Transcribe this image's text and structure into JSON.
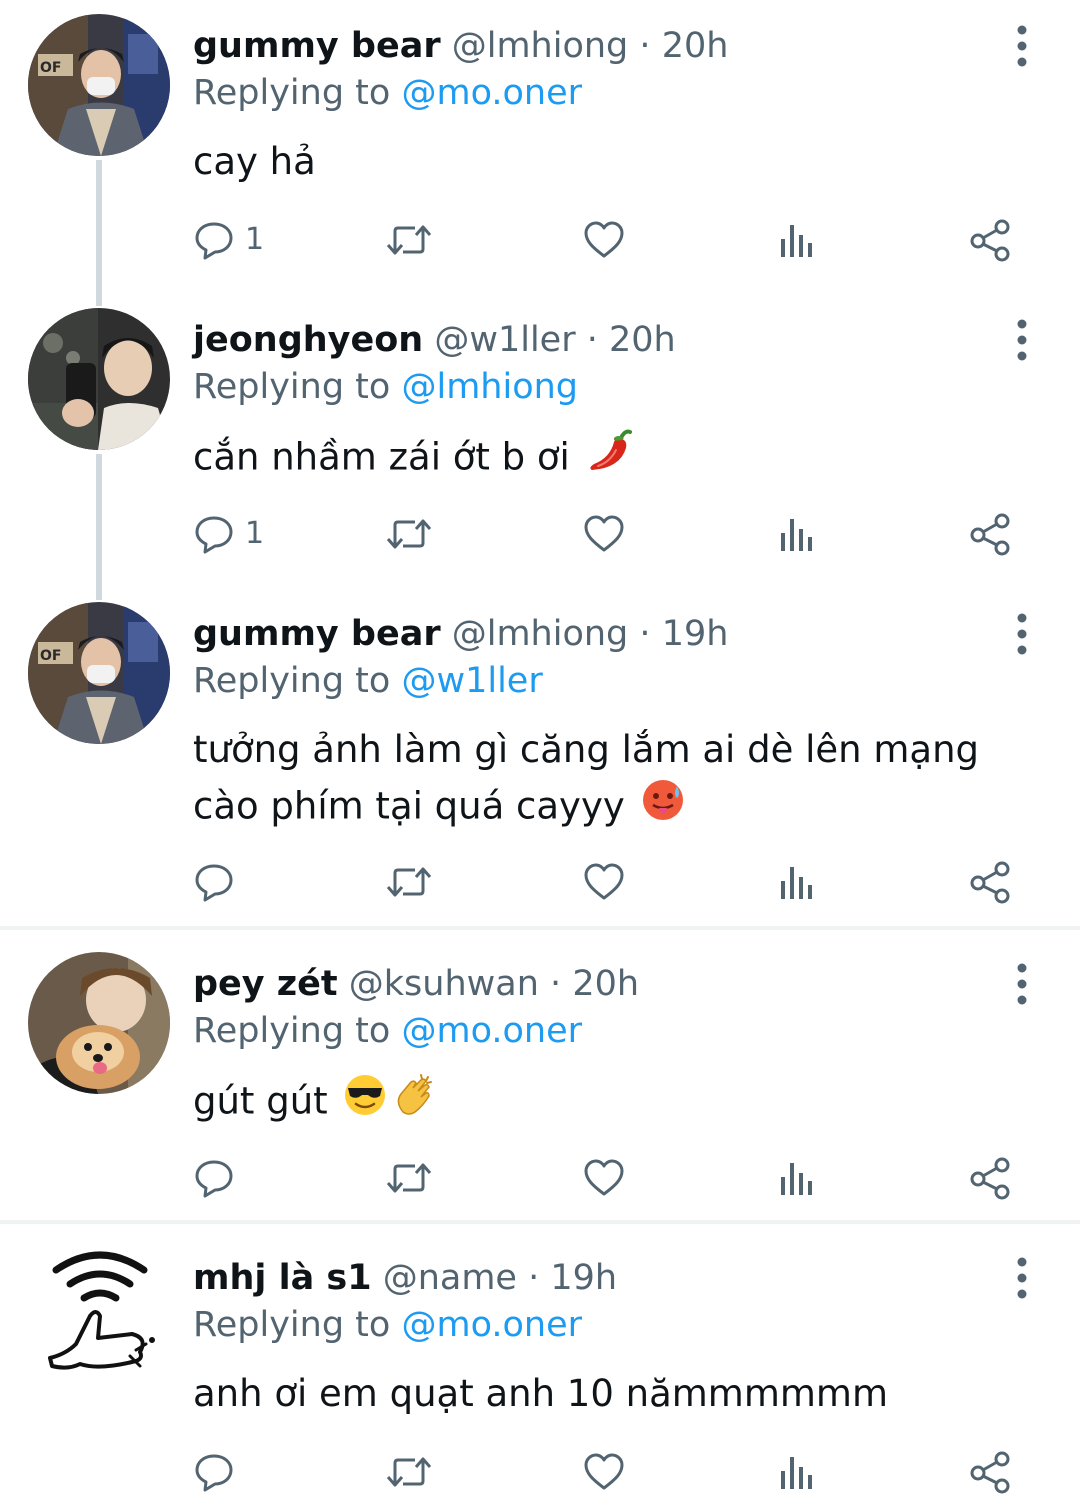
{
  "tweets": [
    {
      "name": "gummy bear",
      "handle": "@lmhiong",
      "separator": "·",
      "time": "20h",
      "replying_prefix": "Replying to",
      "replying_to": "@mo.oner",
      "text": "cay hả",
      "reply_count": "1",
      "avatar": "avatar-photo-masked-man"
    },
    {
      "name": "jeonghyeon",
      "handle": "@w1ller",
      "separator": "·",
      "time": "20h",
      "replying_prefix": "Replying to",
      "replying_to": "@lmhiong",
      "text": "cắn nhầm zái ớt b ơi",
      "emoji": [
        "hot-pepper-emoji"
      ],
      "reply_count": "1",
      "avatar": "avatar-photo-mirror-selfie"
    },
    {
      "name": "gummy bear",
      "handle": "@lmhiong",
      "separator": "·",
      "time": "19h",
      "replying_prefix": "Replying to",
      "replying_to": "@w1ller",
      "text": "tưởng ảnh làm gì căng lắm ai dè lên mạng cào phím tại quá cayyy",
      "emoji": [
        "hot-face-emoji"
      ],
      "reply_count": "",
      "avatar": "avatar-photo-masked-man"
    },
    {
      "name": "pey zét",
      "handle": "@ksuhwan",
      "separator": "·",
      "time": "20h",
      "replying_prefix": "Replying to",
      "replying_to": "@mo.oner",
      "text": "gút gút",
      "emoji": [
        "sunglasses-emoji",
        "clapping-hands-emoji"
      ],
      "reply_count": "",
      "avatar": "avatar-photo-boy-with-dog"
    },
    {
      "name": "mhj là s1",
      "handle": "@name",
      "separator": "·",
      "time": "19h",
      "replying_prefix": "Replying to",
      "replying_to": "@mo.oner",
      "text": "anh ơi em quạt anh 10 nămmmmmm",
      "reply_count": "",
      "avatar": "avatar-drawing-wifi-thumbs-up"
    }
  ],
  "icons": {
    "reply": "reply-icon",
    "retweet": "retweet-icon",
    "like": "heart-icon",
    "views": "views-icon",
    "share": "share-icon",
    "more": "more-icon"
  },
  "colors": {
    "accent": "#1d9bf0",
    "secondary_text": "#536471",
    "primary_text": "#0f1419",
    "thread_line": "#cfd9de",
    "divider": "#eff3f4"
  }
}
